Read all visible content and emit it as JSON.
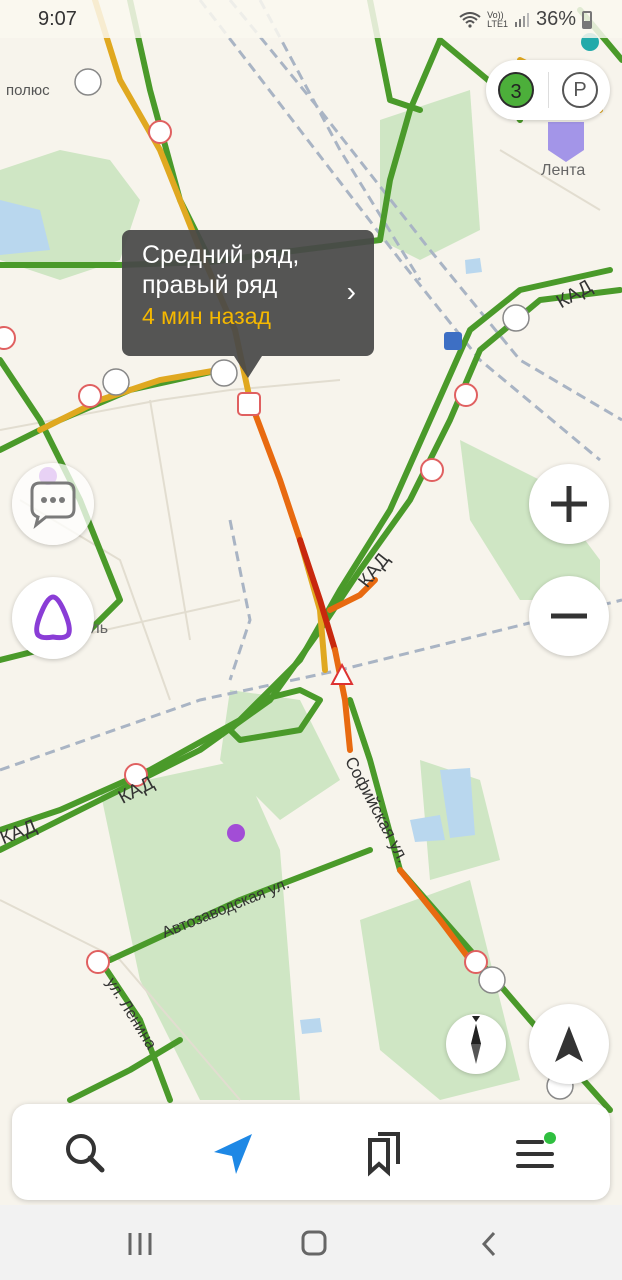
{
  "status_bar": {
    "time": "9:07",
    "network_top": "Vo))",
    "network_bottom": "LTE1",
    "battery": "36%"
  },
  "traffic_popup": {
    "line1": "Средний ряд,",
    "line2": "правый ряд",
    "time_ago": "4 мин назад",
    "chevron": "›"
  },
  "traffic_score": "3",
  "parking_label": "P",
  "map_labels": {
    "poi_polus": "полюс",
    "poi_lenta": "Лента",
    "poi_partial": "сель",
    "kad": "КАД",
    "sofiyskaya": "Софийская ул.",
    "avtozavodskaya": "Автозаводская ул.",
    "lenina": "ул. Ленина"
  },
  "icons": {
    "zoom_in": "plus-icon",
    "zoom_out": "minus-icon",
    "locate": "navigation-arrow-icon",
    "compass": "compass-icon",
    "chat": "chat-bubble-icon",
    "alice": "alice-assistant-icon",
    "search": "search-icon",
    "route": "navigation-icon",
    "bookmarks": "bookmarks-icon",
    "menu": "menu-icon",
    "nav_recent": "recent-apps-icon",
    "nav_home": "home-icon",
    "nav_back": "back-icon"
  },
  "colors": {
    "road_green": "#4a9a2a",
    "road_yellow": "#e0a820",
    "road_orange": "#e86a10",
    "road_red": "#c8280e",
    "accent_blue": "#1e88e5",
    "alice_purple": "#8a3dd6"
  }
}
